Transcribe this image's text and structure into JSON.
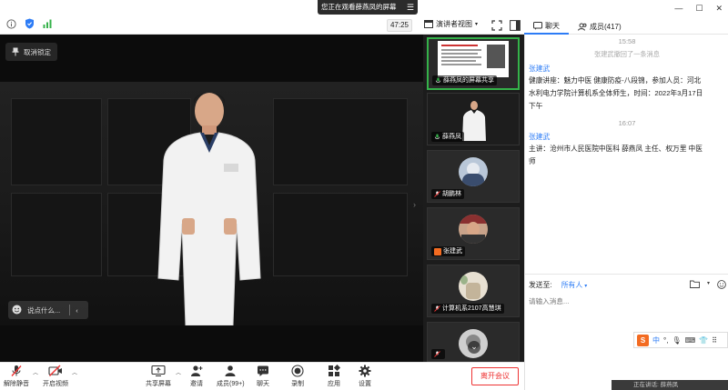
{
  "top": {
    "sharing_banner": "您正在观看薛燕凤的屏幕",
    "timer": "47:25",
    "view_mode": "演讲者视图",
    "tabs": [
      {
        "label": "聊天",
        "icon": "chat-icon"
      },
      {
        "label": "成员(417)",
        "icon": "members-icon"
      }
    ]
  },
  "main": {
    "unpin_label": "取消锁定",
    "say_placeholder": "说点什么..."
  },
  "thumbnails": [
    {
      "name": "薛燕凤的屏幕共享",
      "muted": false
    },
    {
      "name": "薛燕凤",
      "muted": false
    },
    {
      "name": "胡鹏林",
      "muted": true
    },
    {
      "name": "张建武",
      "muted": false
    },
    {
      "name": "计算机系2107高慧琪",
      "muted": true
    },
    {
      "name": "",
      "muted": true
    }
  ],
  "toolbar": {
    "mute": "解除静音",
    "video": "开启视频",
    "share": "共享屏幕",
    "invite": "邀请",
    "members": "成员(99+)",
    "chat": "聊天",
    "record": "录制",
    "apps": "应用",
    "settings": "设置",
    "leave": "离开会议"
  },
  "chat": {
    "time1": "15:58",
    "system_msg": "张建武撤回了一条消息",
    "sender1": "张建武",
    "msg1_line1": "健康讲座：魅力中医  健康防疫-八段锦，参加人员：河北",
    "msg1_line2": "水利电力学院计算机系全体师生，时间：2022年3月17日",
    "msg1_line3": "下午",
    "time2": "16:07",
    "sender2": "张建武",
    "msg2_line1": "主讲：沧州市人民医院中医科 薛燕凤 主任、权万里 中医",
    "msg2_line2": "师",
    "send_to_label": "发送至:",
    "send_to_value": "所有人",
    "input_placeholder": "请输入消息..."
  },
  "ime": {
    "label": "中"
  },
  "toast": "正在讲话: 薛燕凤",
  "colors": {
    "accent": "#2d7cf6",
    "leave": "#ee3333",
    "active_speaker": "#35b24a"
  }
}
